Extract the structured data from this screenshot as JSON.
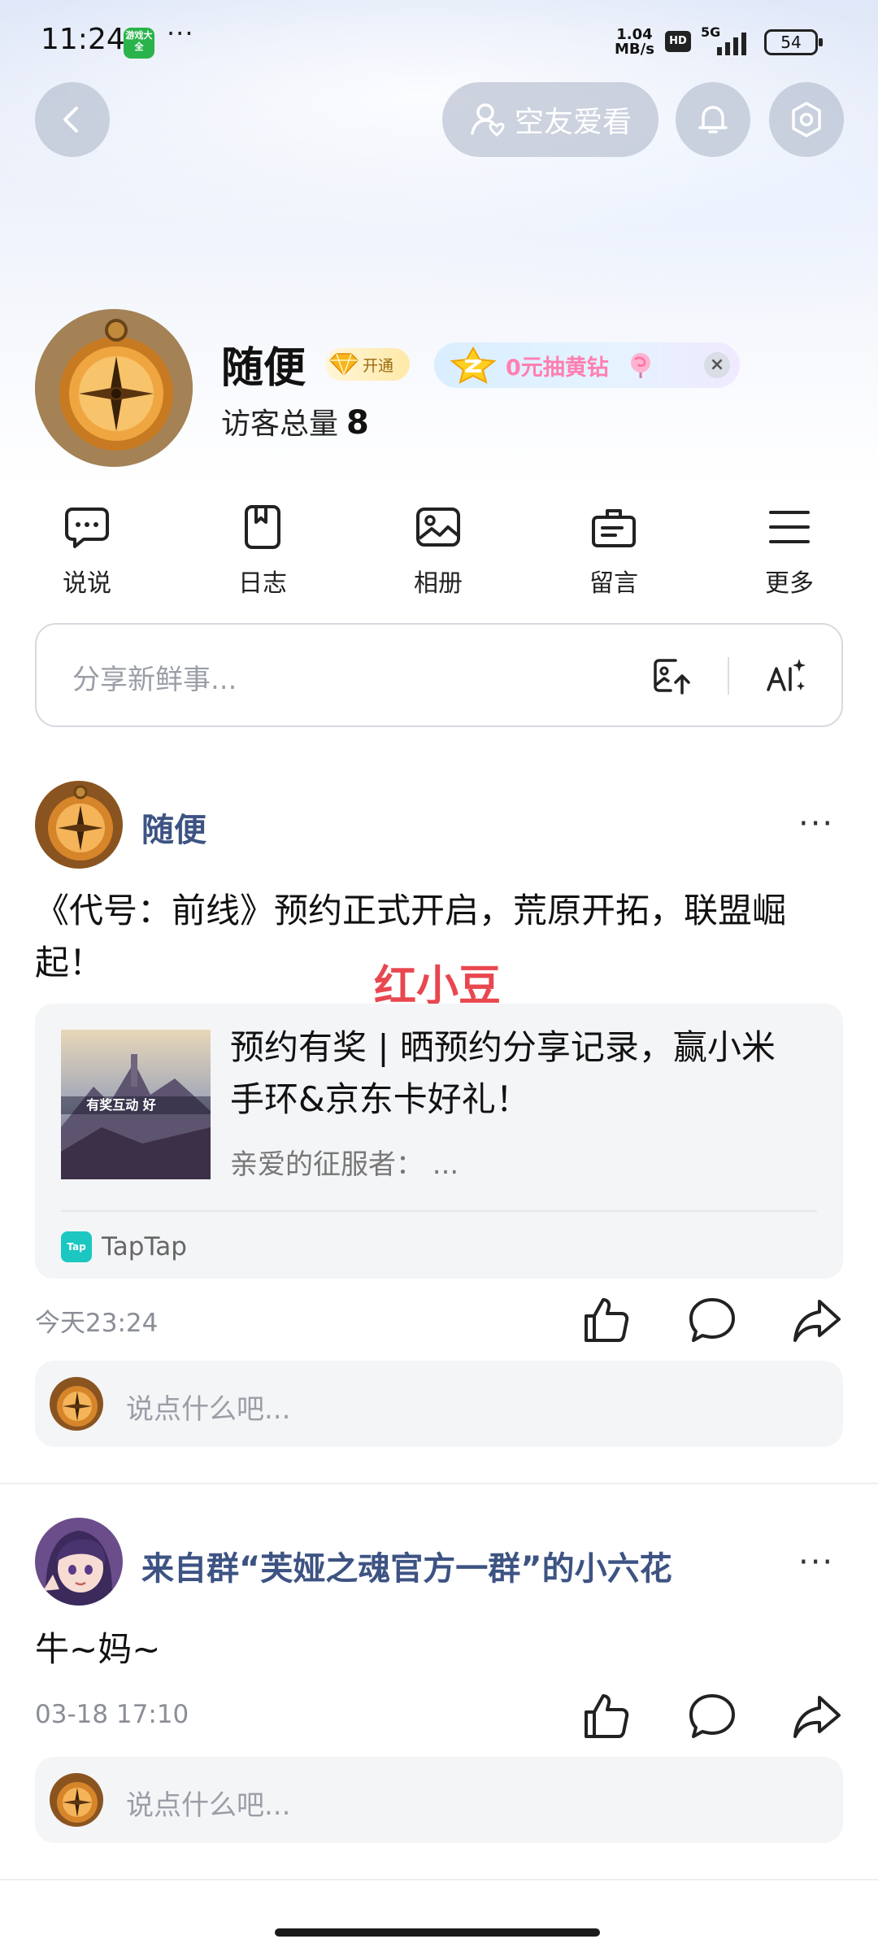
{
  "status_bar": {
    "time": "11:24",
    "app_badge": "游戏大全",
    "more": "···",
    "speed_value": "1.04",
    "speed_unit": "MB/s",
    "hd": "HD",
    "network": "5G",
    "battery": "54"
  },
  "header": {
    "qzone_love_label": "空友爱看"
  },
  "profile": {
    "name": "随便",
    "vip_badge_label": "开通",
    "promo_text": "0元抽黄钻",
    "promo_close": "×",
    "visitors_label": "访客总量",
    "visitors_count": "8"
  },
  "quick_nav": {
    "items": [
      {
        "label": "说说"
      },
      {
        "label": "日志"
      },
      {
        "label": "相册"
      },
      {
        "label": "留言"
      },
      {
        "label": "更多"
      }
    ]
  },
  "composer": {
    "placeholder": "分享新鲜事..."
  },
  "feed": [
    {
      "author": "随便",
      "more": "···",
      "text": "《代号：前线》预约正式开启，荒原开拓，联盟崛起！",
      "link_card": {
        "thumb_text": "有奖互动 好",
        "title": "预约有奖 | 晒预约分享记录，赢小米手环&京东卡好礼！",
        "desc": "亲爱的征服者：  ...",
        "source_logo": "Tap",
        "source": "TapTap"
      },
      "time": "今天23:24",
      "comment_placeholder": "说点什么吧..."
    },
    {
      "author": "来自群“芙娅之魂官方一群”的小六花",
      "more": "···",
      "text": "牛~妈~",
      "time": "03-18 17:10",
      "comment_placeholder": "说点什么吧..."
    }
  ],
  "overlay": {
    "watermark": "红小豆"
  },
  "colors": {
    "name_link": "#3d5383",
    "watermark": "#e8474f",
    "taptap": "#1cc7c2"
  }
}
